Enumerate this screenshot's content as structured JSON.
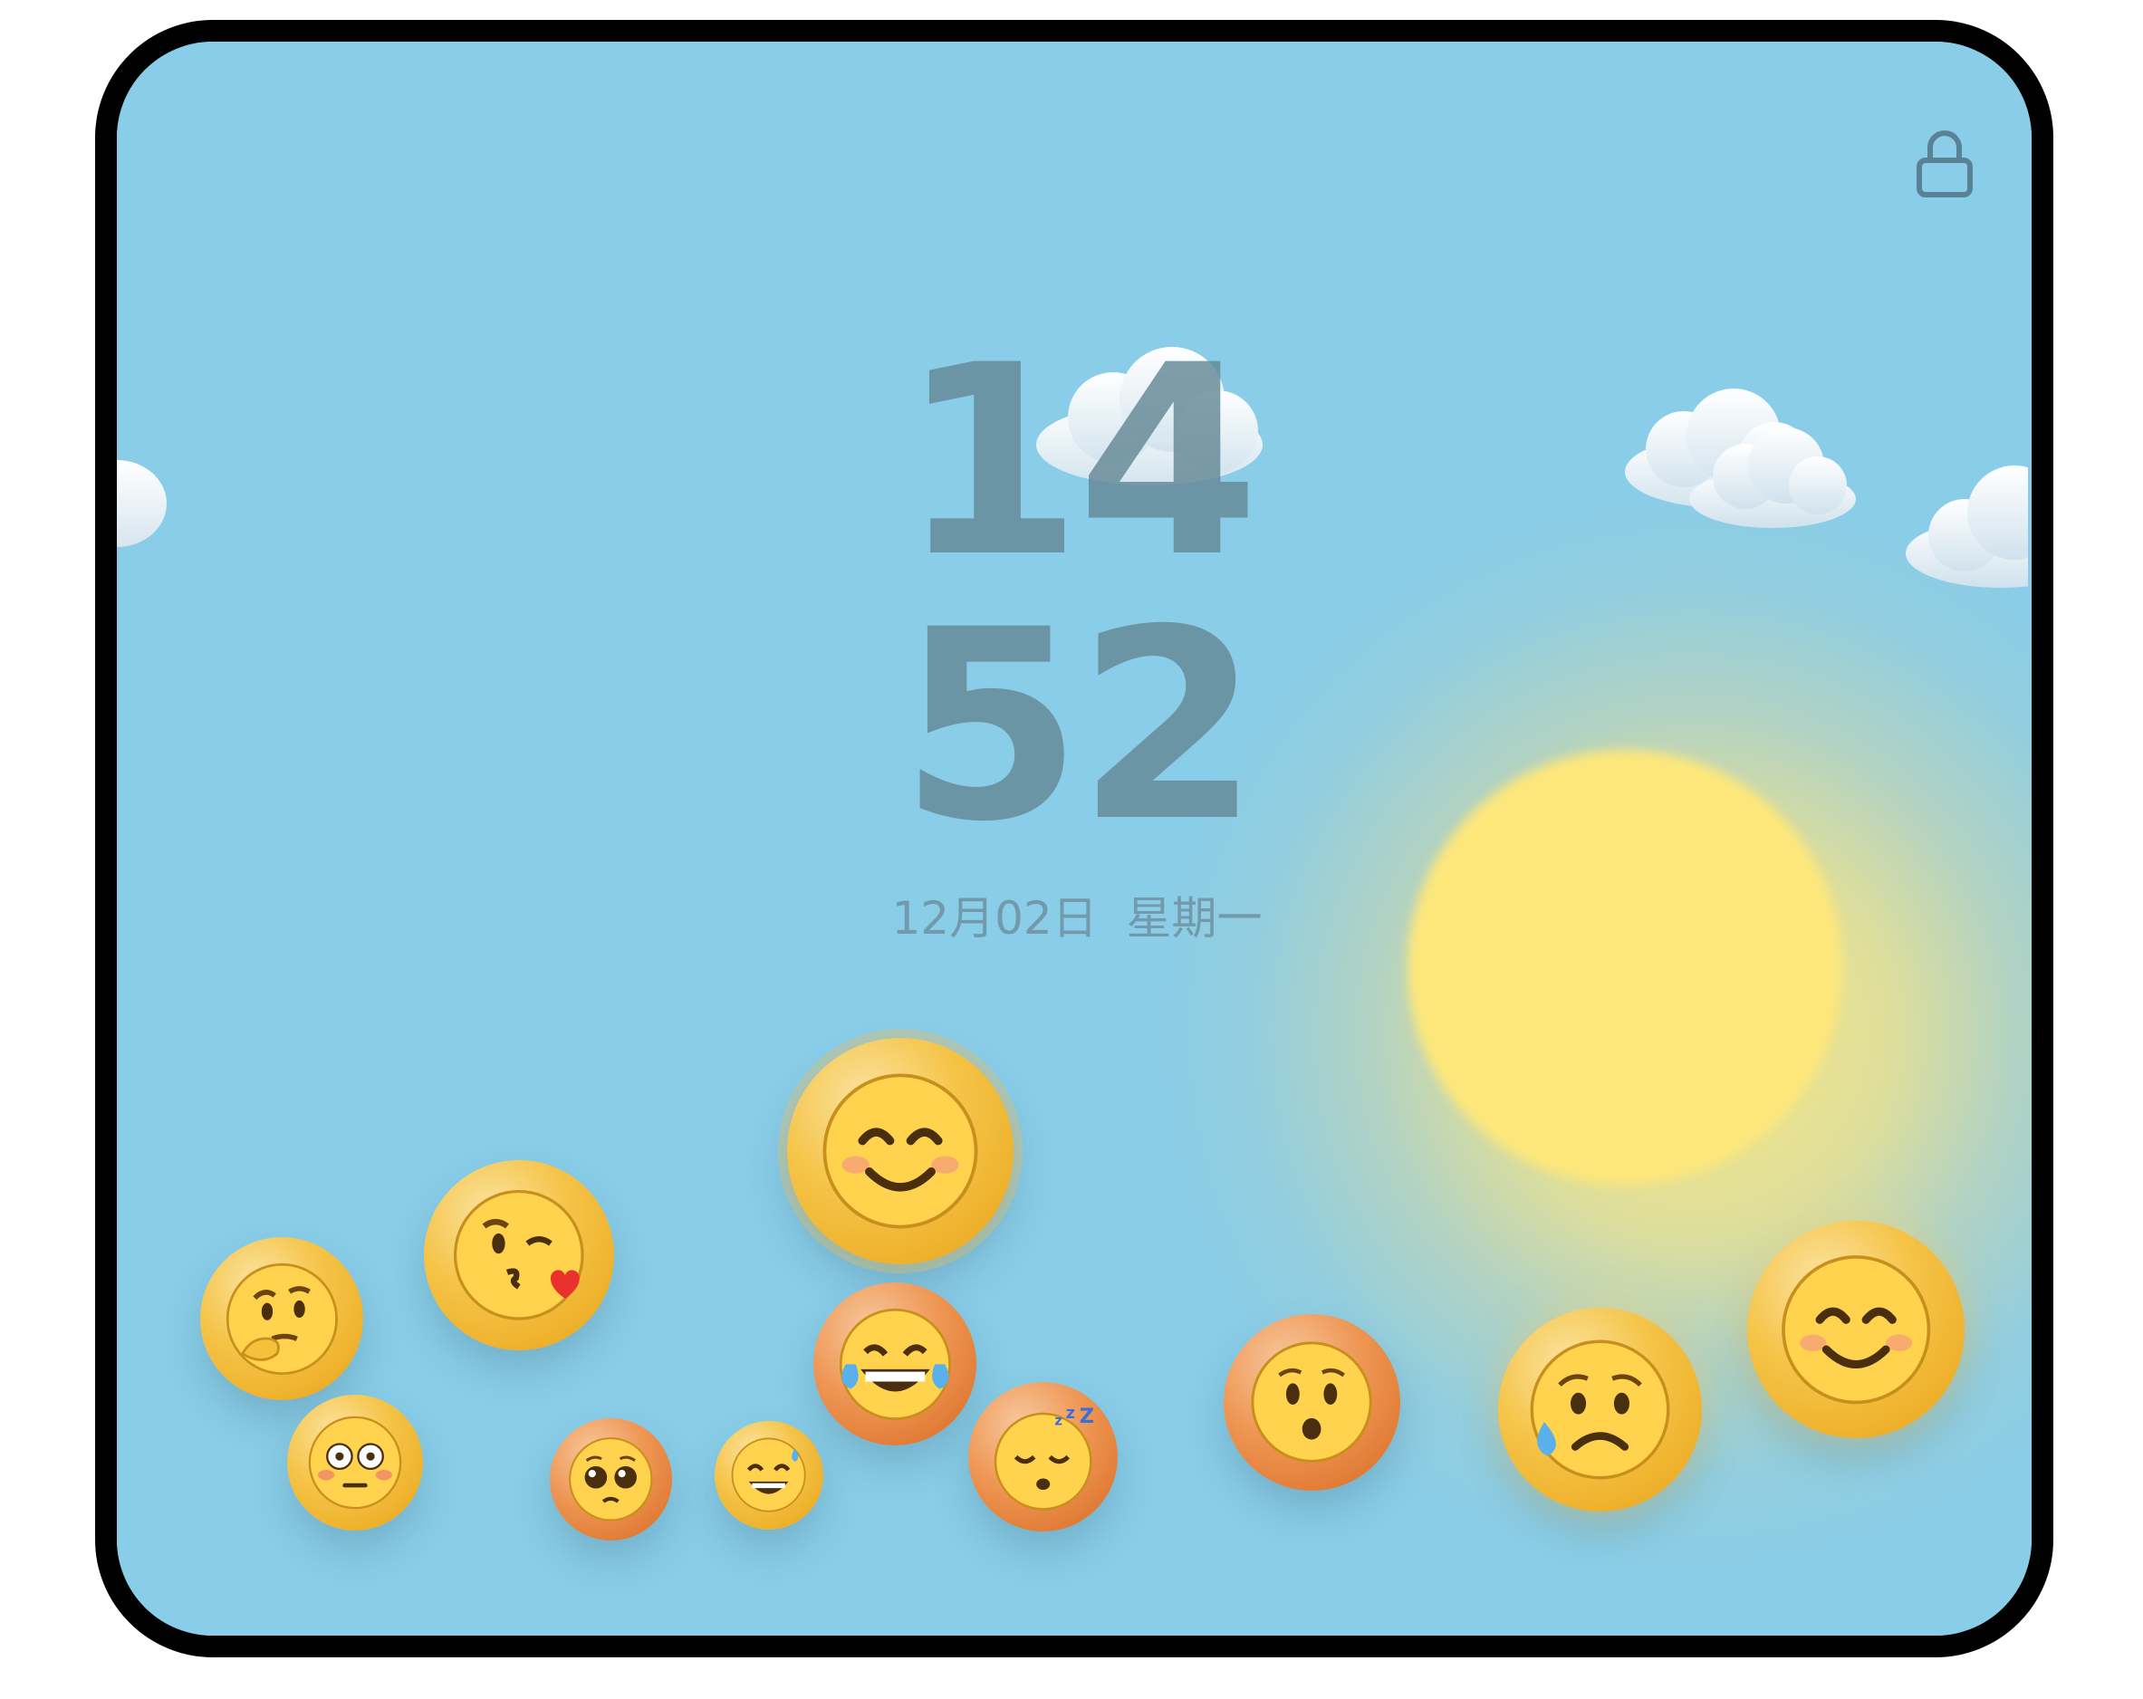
{
  "status": {
    "lock_icon": "lock-icon"
  },
  "clock": {
    "hours": "14",
    "minutes": "52",
    "date": "12月02日  星期一"
  },
  "colors": {
    "sky": "#89cde8",
    "sun": "#fde77b",
    "clock_text": "#64879a",
    "bubble_gold": "#f5c448",
    "bubble_orange": "#ee9653",
    "face_yellow": "#ffd34d",
    "face_outline": "#b47b1c"
  },
  "emoji_bubbles": [
    {
      "name": "thinking-face-icon",
      "tone": "gold"
    },
    {
      "name": "kissing-heart-face-icon",
      "tone": "gold"
    },
    {
      "name": "smiling-face-icon",
      "tone": "gold"
    },
    {
      "name": "flushed-face-icon",
      "tone": "gold"
    },
    {
      "name": "pleading-face-icon",
      "tone": "orange"
    },
    {
      "name": "sweat-smile-face-icon",
      "tone": "gold"
    },
    {
      "name": "joy-face-icon",
      "tone": "orange"
    },
    {
      "name": "sleeping-face-icon",
      "tone": "orange"
    },
    {
      "name": "hushed-face-icon",
      "tone": "orange"
    },
    {
      "name": "sad-sweat-face-icon",
      "tone": "gold"
    },
    {
      "name": "smiling-face-icon",
      "tone": "gold"
    }
  ]
}
